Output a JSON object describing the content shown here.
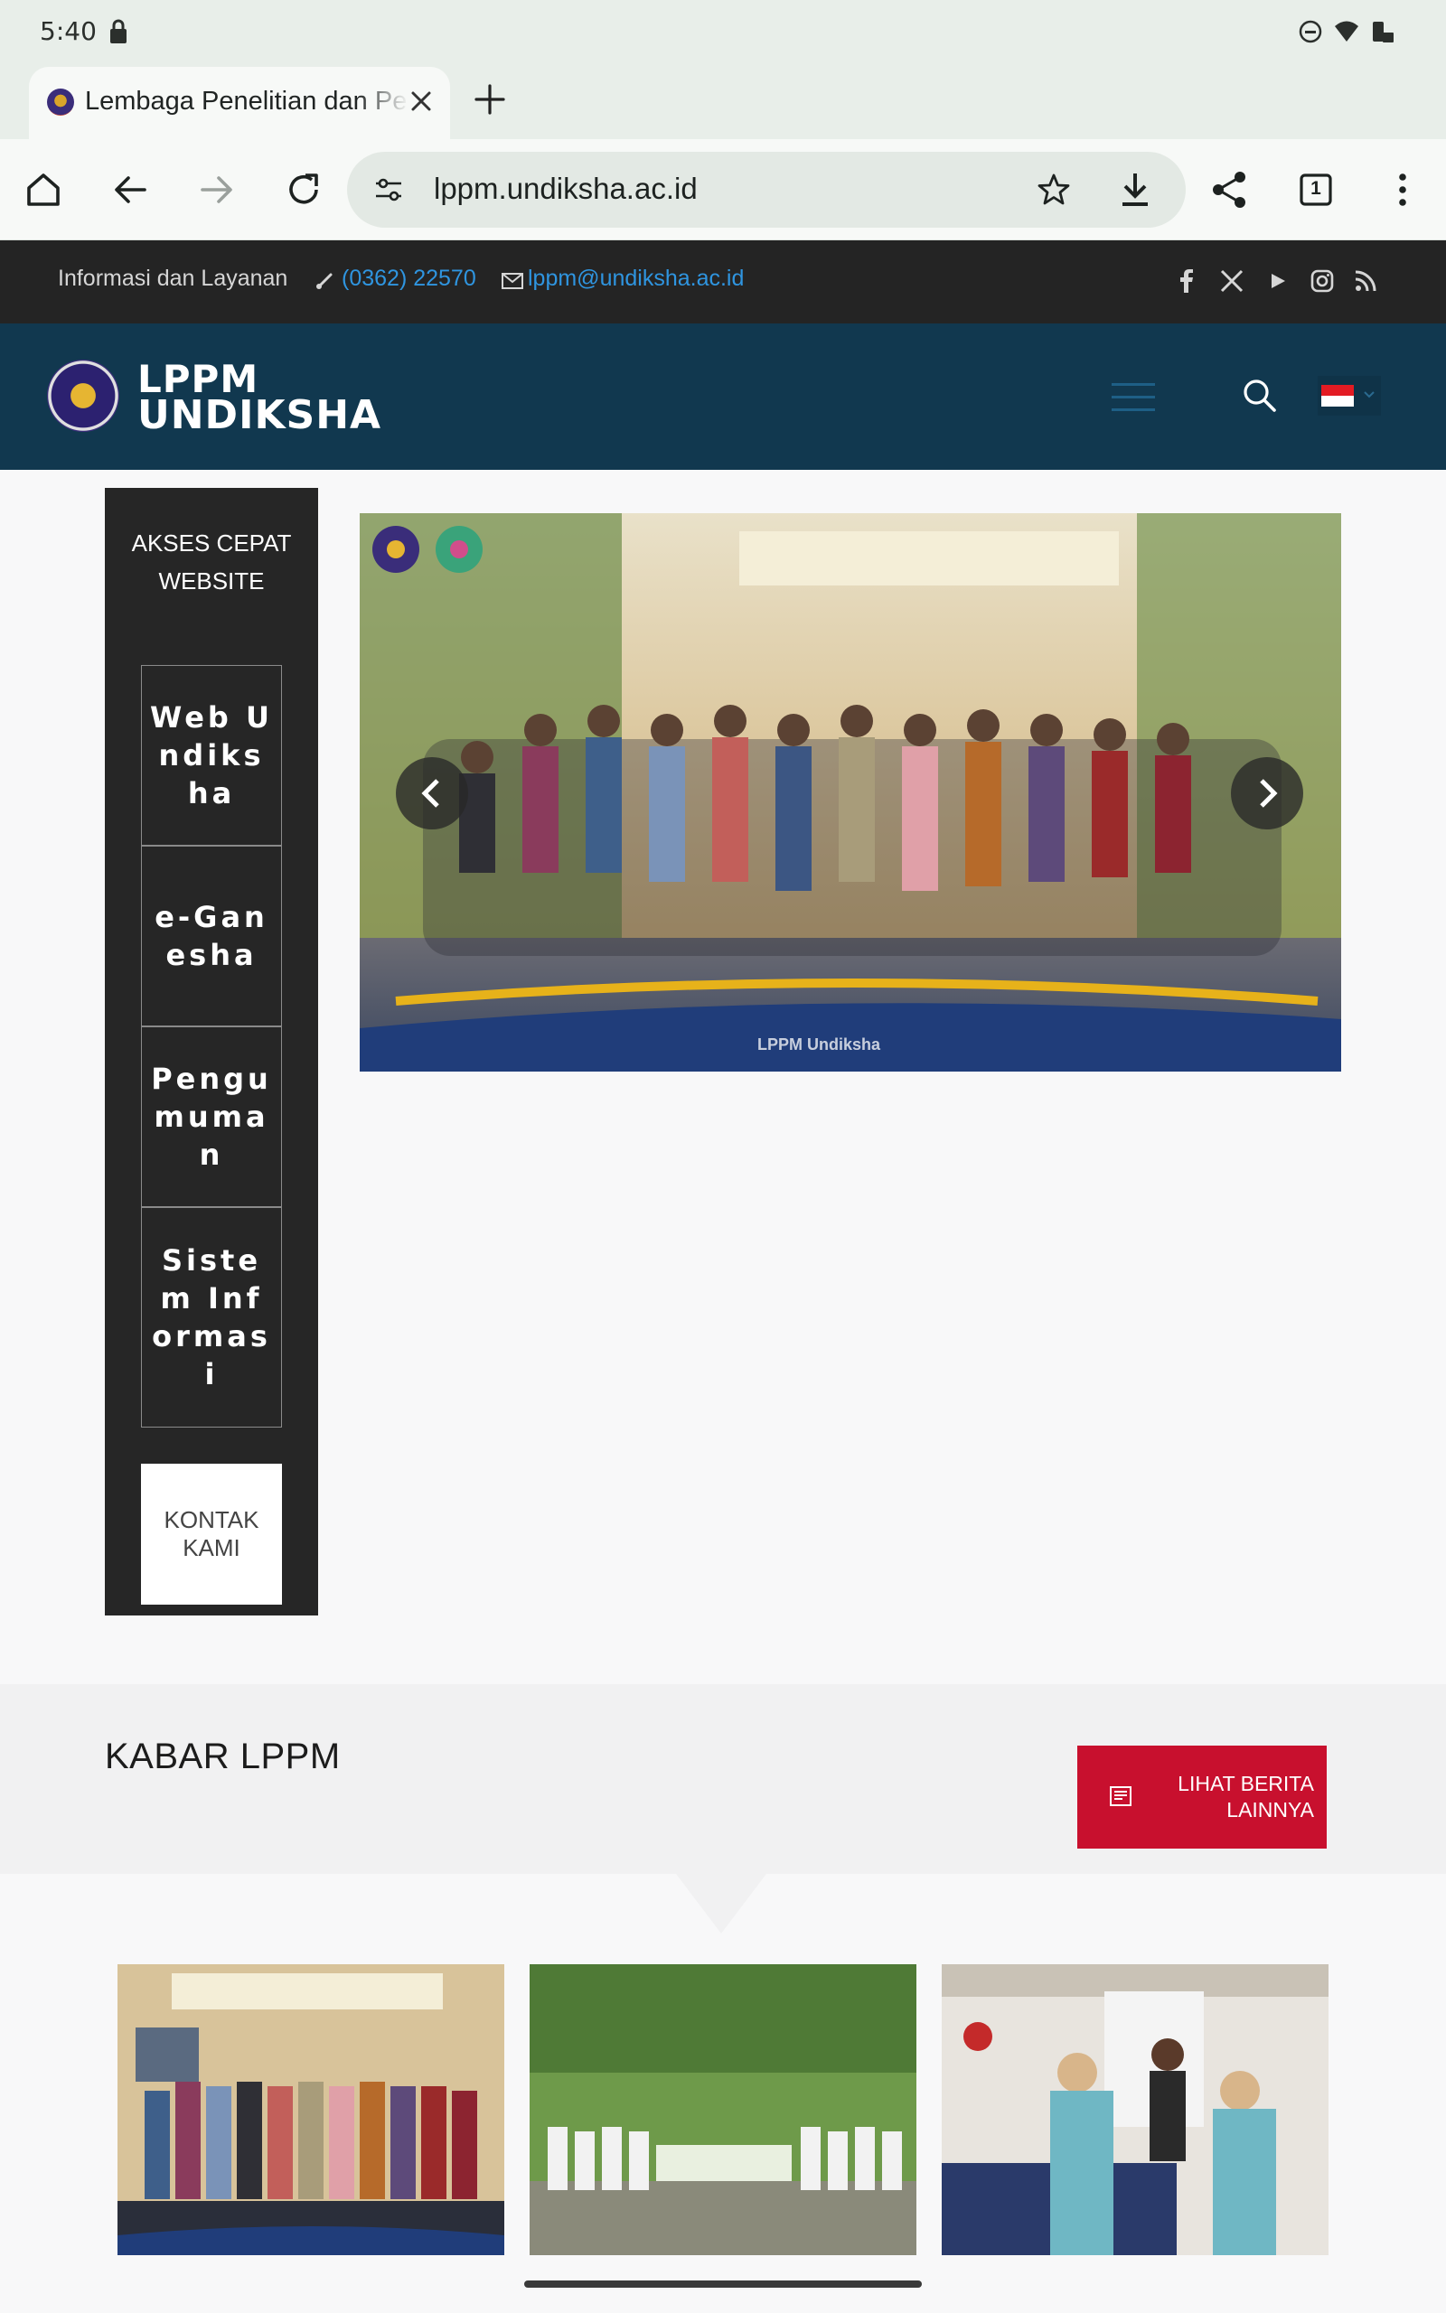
{
  "status_bar": {
    "time": "5:40"
  },
  "browser": {
    "tab_title": "Lembaga Penelitian dan Pengabdian kepada Masyarakat",
    "url": "lppm.undiksha.ac.id",
    "tab_count": "1"
  },
  "site": {
    "info_label": "Informasi dan Layanan",
    "phone": "(0362) 22570",
    "email": "lppm@undiksha.ac.id",
    "logo_line1": "LPPM",
    "logo_line2": "UNDIKSHA",
    "social_icons": [
      "facebook-icon",
      "x-icon",
      "youtube-icon",
      "instagram-icon",
      "rss-icon"
    ],
    "accent_color": "#c8102e",
    "header_color": "#11384f"
  },
  "quick_access": {
    "title": "AKSES CEPAT WEBSITE",
    "items": [
      "Web Undiksha",
      "e-Ganesha",
      "Pengumuman",
      "Sistem Informasi"
    ],
    "contact": "KONTAK KAMI"
  },
  "hero": {
    "caption": "LPPM Undiksha"
  },
  "news": {
    "title": "KABAR LPPM",
    "more_button": "LIHAT BERITA LAINNYA"
  }
}
